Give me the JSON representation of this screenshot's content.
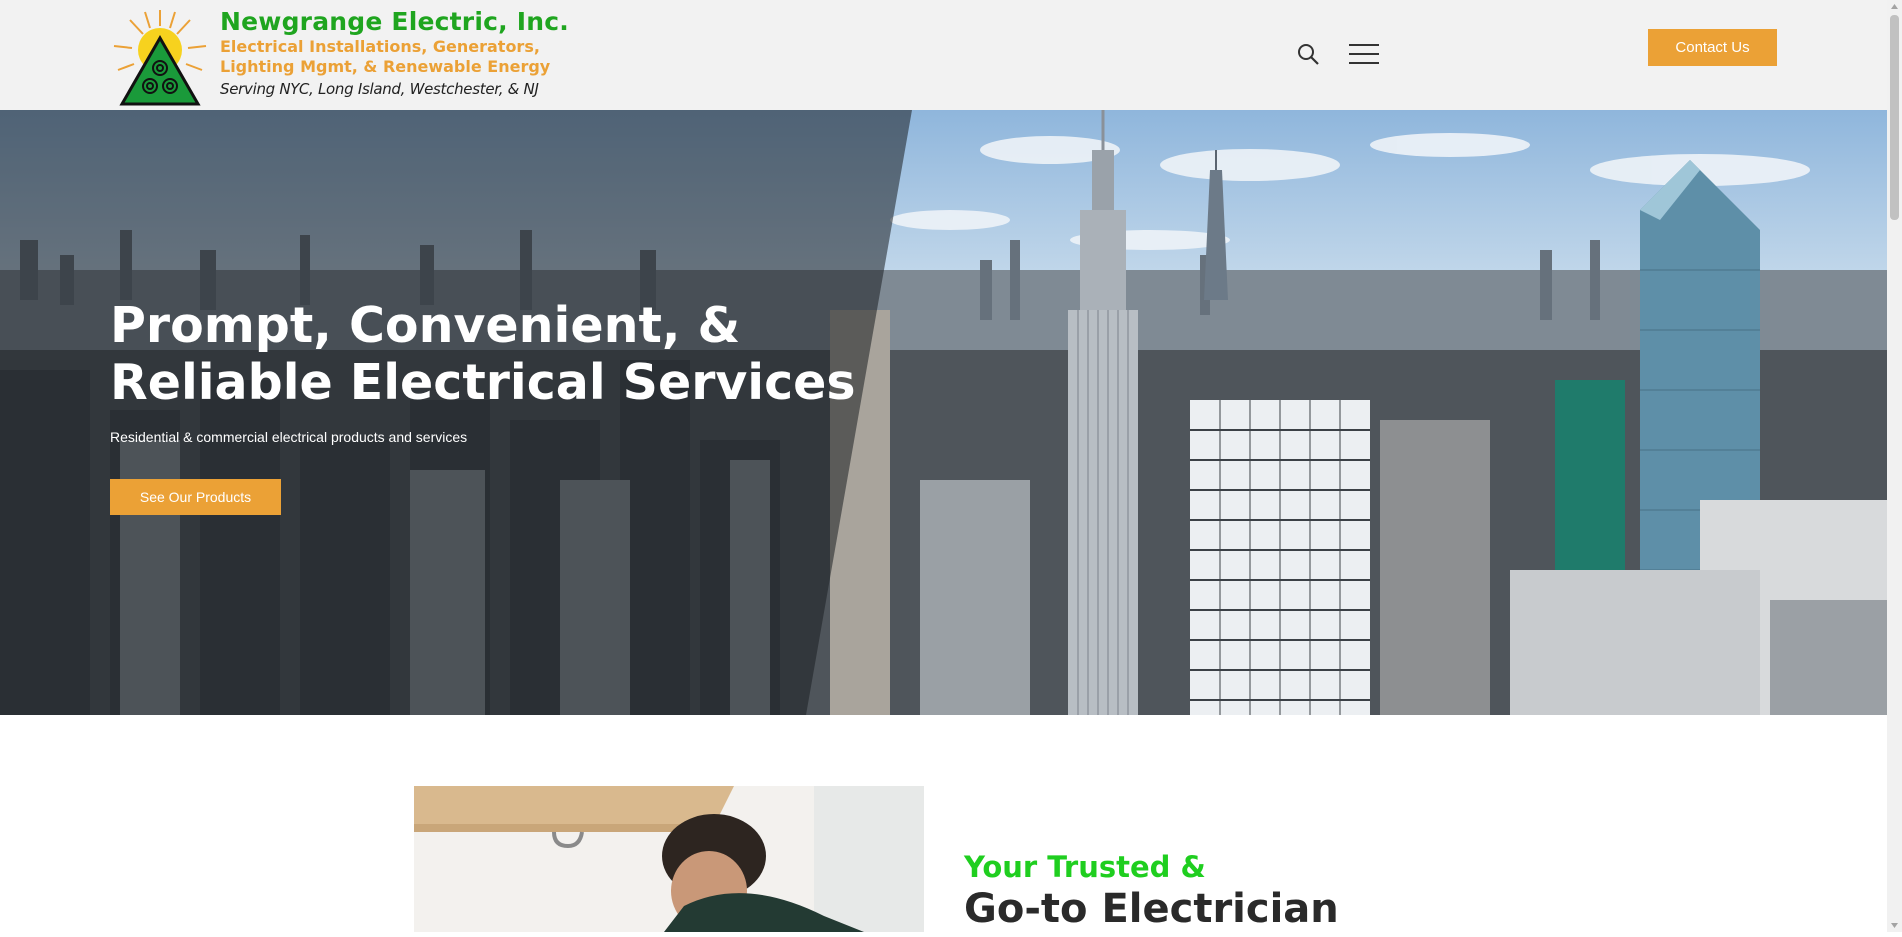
{
  "header": {
    "brand_name": "Newgrange Electric, Inc.",
    "brand_tagline_line1": "Electrical Installations, Generators,",
    "brand_tagline_line2": "Lighting Mgmt, & Renewable Energy",
    "service_area": "Serving NYC, Long Island, Westchester, & NJ",
    "search_icon": "search-icon",
    "menu_icon": "hamburger-menu-icon",
    "contact_label": "Contact Us"
  },
  "hero": {
    "title_line1": "Prompt, Convenient, &",
    "title_line2": "Reliable Electrical Services",
    "subtitle": "Residential & commercial electrical products and services",
    "cta_label": "See Our Products"
  },
  "intro": {
    "kicker": "Your Trusted &",
    "title": "Go-to Electrician"
  },
  "colors": {
    "brand_green": "#1fa51f",
    "accent_orange": "#eba136",
    "header_bg": "#f2f2f2"
  }
}
